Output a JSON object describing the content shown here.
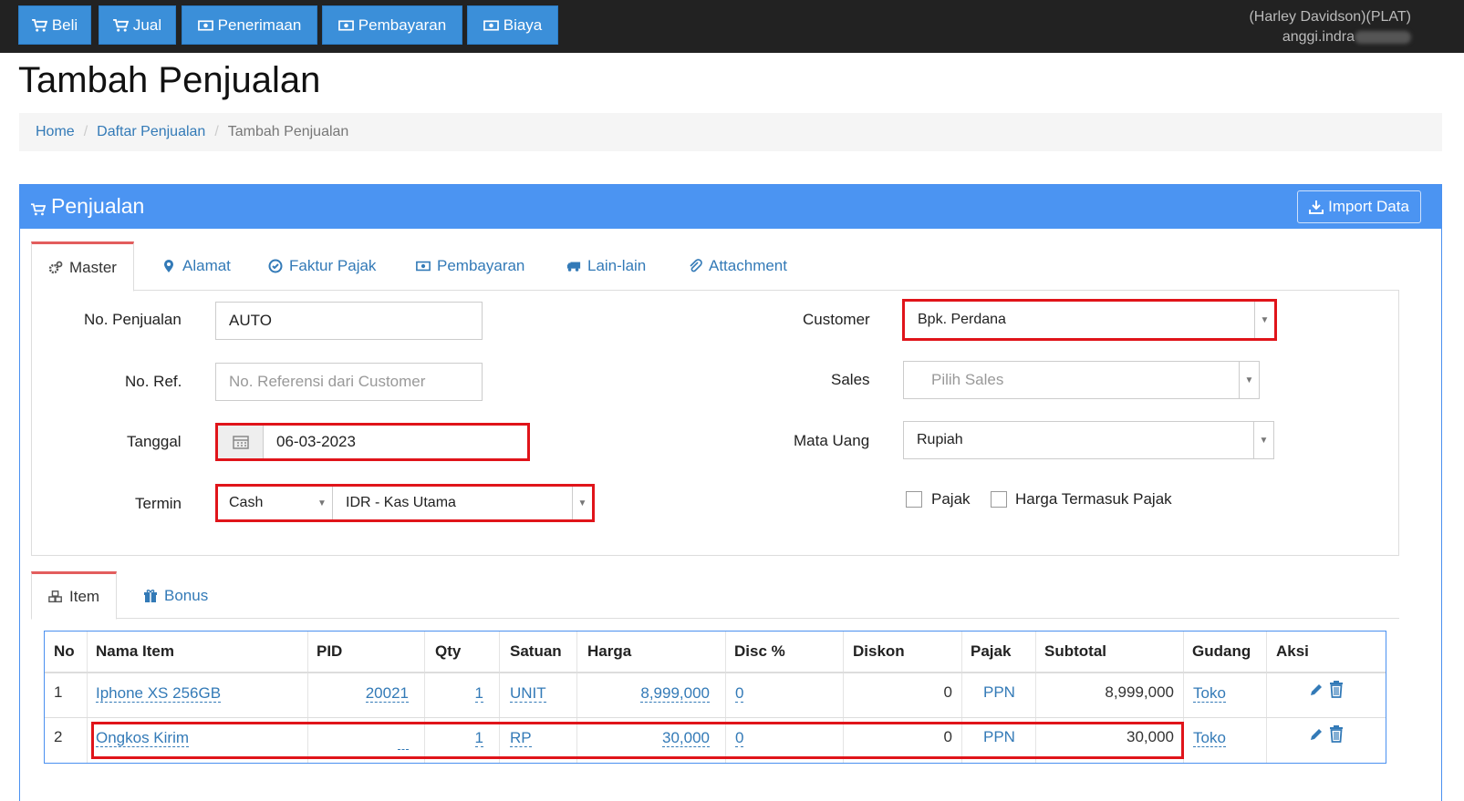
{
  "nav": {
    "buttons": [
      "Beli",
      "Jual",
      "Penerimaan",
      "Pembayaran",
      "Biaya"
    ],
    "company": "(Harley Davidson)(PLAT)",
    "user": "anggi.indra"
  },
  "page": {
    "title": "Tambah Penjualan"
  },
  "breadcrumb": {
    "home": "Home",
    "list": "Daftar Penjualan",
    "current": "Tambah Penjualan"
  },
  "panel": {
    "title": "Penjualan",
    "import_label": "Import Data"
  },
  "tabs": [
    "Master",
    "Alamat",
    "Faktur Pajak",
    "Pembayaran",
    "Lain-lain",
    "Attachment"
  ],
  "form": {
    "no_penjualan": {
      "label": "No. Penjualan",
      "value": "AUTO"
    },
    "no_ref": {
      "label": "No. Ref.",
      "placeholder": "No. Referensi dari Customer"
    },
    "tanggal": {
      "label": "Tanggal",
      "value": "06-03-2023"
    },
    "termin": {
      "label": "Termin",
      "value": "Cash",
      "account": "IDR - Kas Utama"
    },
    "customer": {
      "label": "Customer",
      "value": "Bpk. Perdana"
    },
    "sales": {
      "label": "Sales",
      "placeholder": "Pilih Sales"
    },
    "mata_uang": {
      "label": "Mata Uang",
      "value": "Rupiah"
    },
    "pajak_label": "Pajak",
    "harga_termasuk_pajak_label": "Harga Termasuk Pajak"
  },
  "item_tabs": [
    "Item",
    "Bonus"
  ],
  "table": {
    "headers": [
      "No",
      "Nama Item",
      "PID",
      "Qty",
      "Satuan",
      "Harga",
      "Disc %",
      "Diskon",
      "Pajak",
      "Subtotal",
      "Gudang",
      "Aksi"
    ],
    "rows": [
      {
        "no": "1",
        "nama": "Iphone XS 256GB",
        "pid": "20021",
        "qty": "1",
        "satuan": "UNIT",
        "harga": "8,999,000",
        "disc": "0",
        "diskon": "0",
        "pajak": "PPN",
        "subtotal": "8,999,000",
        "gudang": "Toko"
      },
      {
        "no": "2",
        "nama": "Ongkos Kirim",
        "pid": "",
        "qty": "1",
        "satuan": "RP",
        "harga": "30,000",
        "disc": "0",
        "diskon": "0",
        "pajak": "PPN",
        "subtotal": "30,000",
        "gudang": "Toko"
      }
    ]
  },
  "colors": {
    "primary": "#4b94f2",
    "nav_btn": "#3b8fd9",
    "highlight": "#e0141a",
    "link": "#337ab7"
  }
}
